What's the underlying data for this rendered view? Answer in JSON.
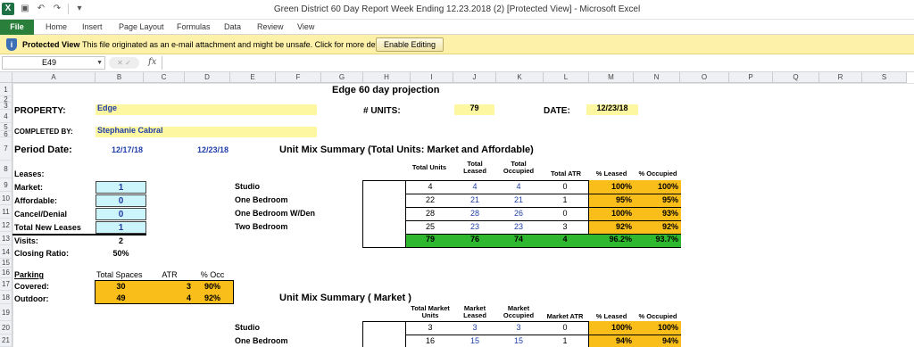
{
  "window": {
    "title": "Green District 60 Day Report Week Ending 12.23.2018 (2)  [Protected View]  -  Microsoft Excel",
    "logo_letter": "X"
  },
  "ribbon": {
    "file": "File",
    "tabs": [
      "Home",
      "Insert",
      "Page Layout",
      "Formulas",
      "Data",
      "Review",
      "View"
    ]
  },
  "protected_view": {
    "title": "Protected View",
    "message": "This file originated as an e-mail attachment and might be unsafe. Click for more details.",
    "button": "Enable Editing"
  },
  "formula_bar": {
    "name_box": "E49",
    "fx": "fx",
    "formula": ""
  },
  "columns": [
    "A",
    "B",
    "C",
    "D",
    "E",
    "F",
    "G",
    "H",
    "I",
    "J",
    "K",
    "L",
    "M",
    "N",
    "O",
    "P",
    "Q",
    "R",
    "S"
  ],
  "rows": [
    "1",
    "2",
    "3",
    "4",
    "5",
    "6",
    "7",
    "8",
    "9",
    "10",
    "11",
    "12",
    "13",
    "14",
    "15",
    "16",
    "17",
    "18",
    "19",
    "20",
    "21"
  ],
  "sheet": {
    "title": "Edge 60 day projection",
    "property_label": "PROPERTY:",
    "property": "Edge",
    "units_label": "# UNITS:",
    "units": "79",
    "date_label": "DATE:",
    "date": "12/23/18",
    "completed_label": "COMPLETED BY:",
    "completed_by": "Stephanie Cabral",
    "period_label": "Period Date:",
    "period_start": "12/17/18",
    "period_end": "12/23/18",
    "leases_label": "Leases:",
    "leases": [
      {
        "label": "Market:",
        "value": "1"
      },
      {
        "label": "Affordable:",
        "value": "0"
      },
      {
        "label": "Cancel/Denial",
        "value": "0"
      },
      {
        "label": "Total New Leases",
        "value": "1"
      }
    ],
    "visits_label": "Visits:",
    "visits": "2",
    "closing_label": "Closing Ratio:",
    "closing": "50%",
    "parking": {
      "label": "Parking",
      "headers": [
        "Total Spaces",
        "ATR",
        "% Occ"
      ],
      "rows": [
        {
          "label": "Covered:",
          "total": "30",
          "atr": "3",
          "occ": "90%"
        },
        {
          "label": "Outdoor:",
          "total": "49",
          "atr": "4",
          "occ": "92%"
        }
      ]
    },
    "summary1": {
      "title": "Unit Mix Summary (Total Units: Market and Affordable)",
      "headers": [
        "Total Units",
        "Total Leased",
        "Total Occupied",
        "Total ATR",
        "% Leased",
        "% Occupied"
      ],
      "rows": [
        {
          "type": "Studio",
          "v": [
            "4",
            "4",
            "4",
            "0",
            "100%",
            "100%"
          ]
        },
        {
          "type": "One Bedroom",
          "v": [
            "22",
            "21",
            "21",
            "1",
            "95%",
            "95%"
          ]
        },
        {
          "type": "One Bedroom W/Den",
          "v": [
            "28",
            "28",
            "26",
            "0",
            "100%",
            "93%"
          ]
        },
        {
          "type": "Two Bedroom",
          "v": [
            "25",
            "23",
            "23",
            "3",
            "92%",
            "92%"
          ]
        }
      ],
      "totals": [
        "79",
        "76",
        "74",
        "4",
        "96.2%",
        "93.7%"
      ]
    },
    "summary2": {
      "title": "Unit Mix Summary ( Market )",
      "headers": [
        "Total Market Units",
        "Market Leased",
        "Market Occupied",
        "Market ATR",
        "% Leased",
        "% Occupied"
      ],
      "rows": [
        {
          "type": "Studio",
          "v": [
            "3",
            "3",
            "3",
            "0",
            "100%",
            "100%"
          ]
        },
        {
          "type": "One Bedroom",
          "v": [
            "16",
            "15",
            "15",
            "1",
            "94%",
            "94%"
          ]
        }
      ]
    }
  }
}
